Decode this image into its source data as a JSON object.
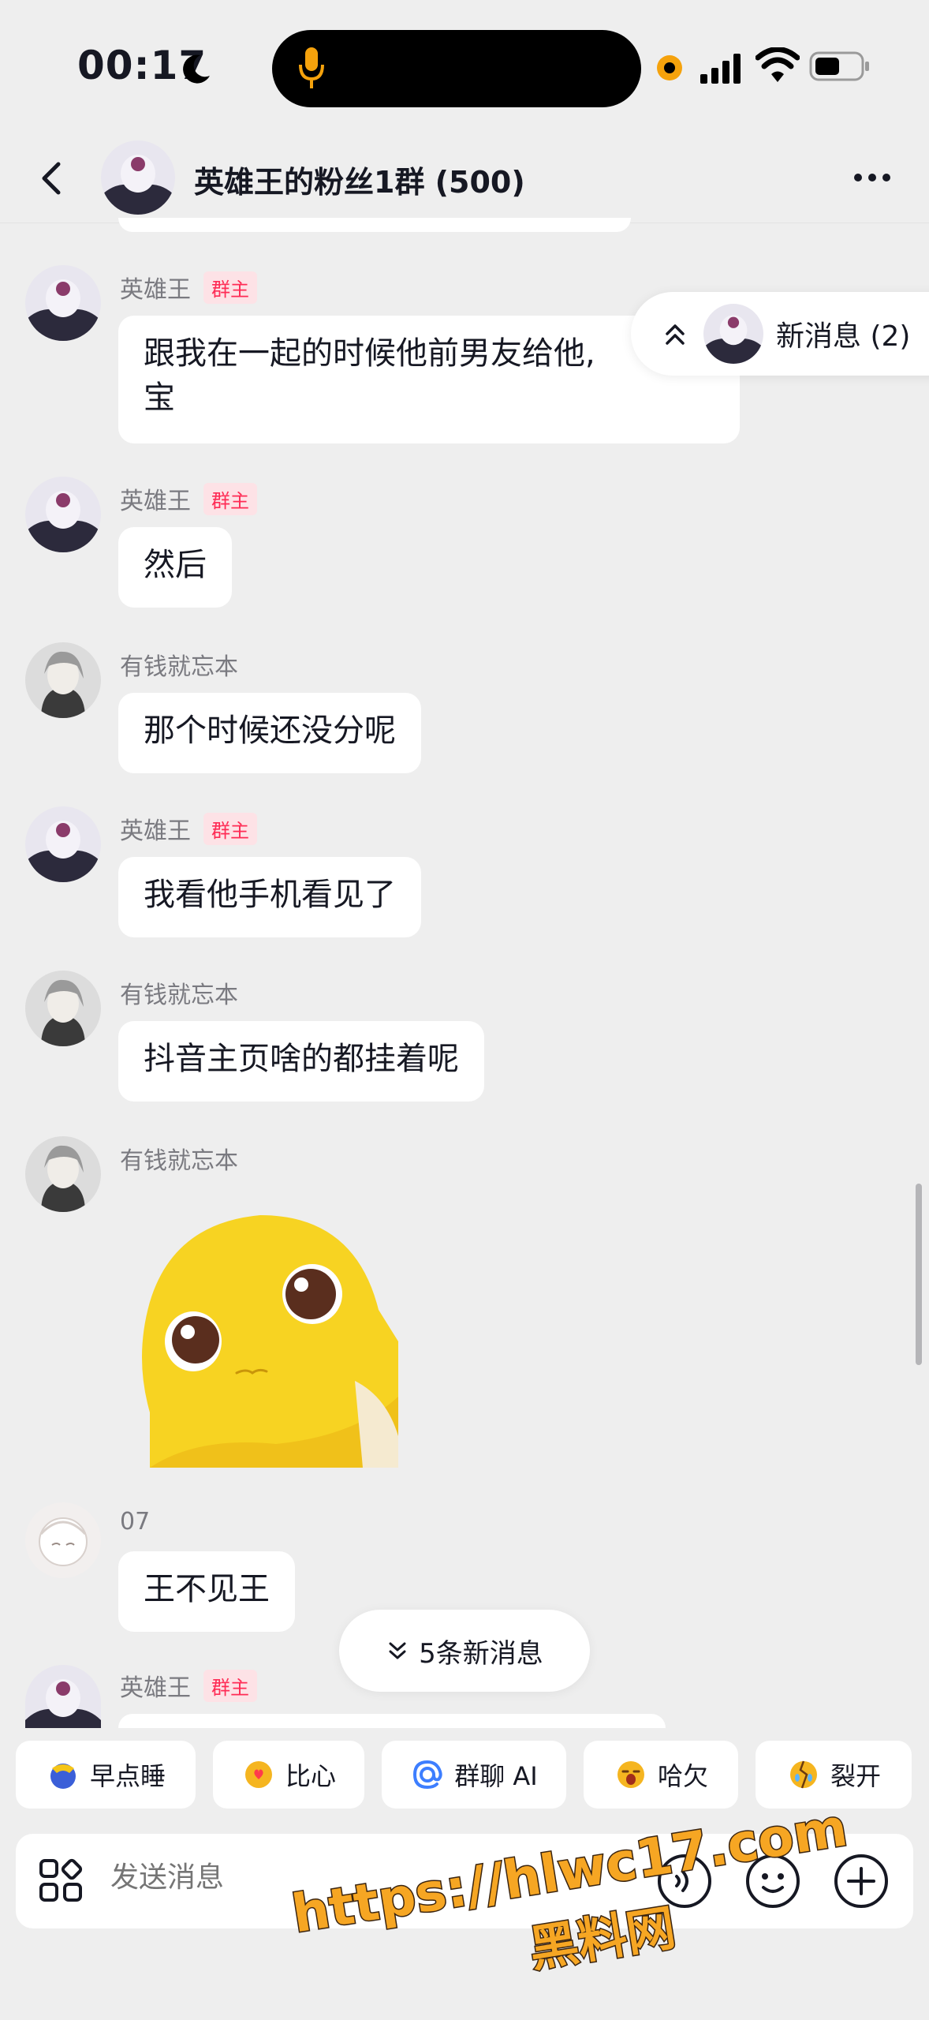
{
  "status_bar": {
    "time": "00:17"
  },
  "header": {
    "title": "英雄王的粉丝1群 (500)"
  },
  "new_messages_pill": {
    "label": "新消息 (2)"
  },
  "messages": [
    {
      "sender": "英雄王",
      "badge": "群主",
      "text_line1": "跟我在一起的时候他前男友给他, ",
      "text_line2": "宝"
    },
    {
      "sender": "英雄王",
      "badge": "群主",
      "text": "然后"
    },
    {
      "sender": "有钱就忘本",
      "text": "那个时候还没分呢"
    },
    {
      "sender": "英雄王",
      "badge": "群主",
      "text": "我看他手机看见了"
    },
    {
      "sender": "有钱就忘本",
      "text": "抖音主页啥的都挂着呢"
    },
    {
      "sender": "有钱就忘本",
      "sticker": "yellow-duck-sticker"
    },
    {
      "sender": "07",
      "text": "王不见王"
    },
    {
      "sender": "英雄王",
      "badge": "群主"
    }
  ],
  "unread_pill": {
    "label": "5条新消息"
  },
  "quick_replies": [
    "早点睡",
    "比心",
    "群聊 AI",
    "哈欠",
    "裂开"
  ],
  "input": {
    "placeholder": "发送消息"
  },
  "watermark": {
    "line1": "https://hlwc17.com",
    "line2": "黑料网"
  },
  "colors": {
    "badge_red": "#fe2c55",
    "badge_bg": "#fde2e6",
    "background": "#eeeeee"
  }
}
